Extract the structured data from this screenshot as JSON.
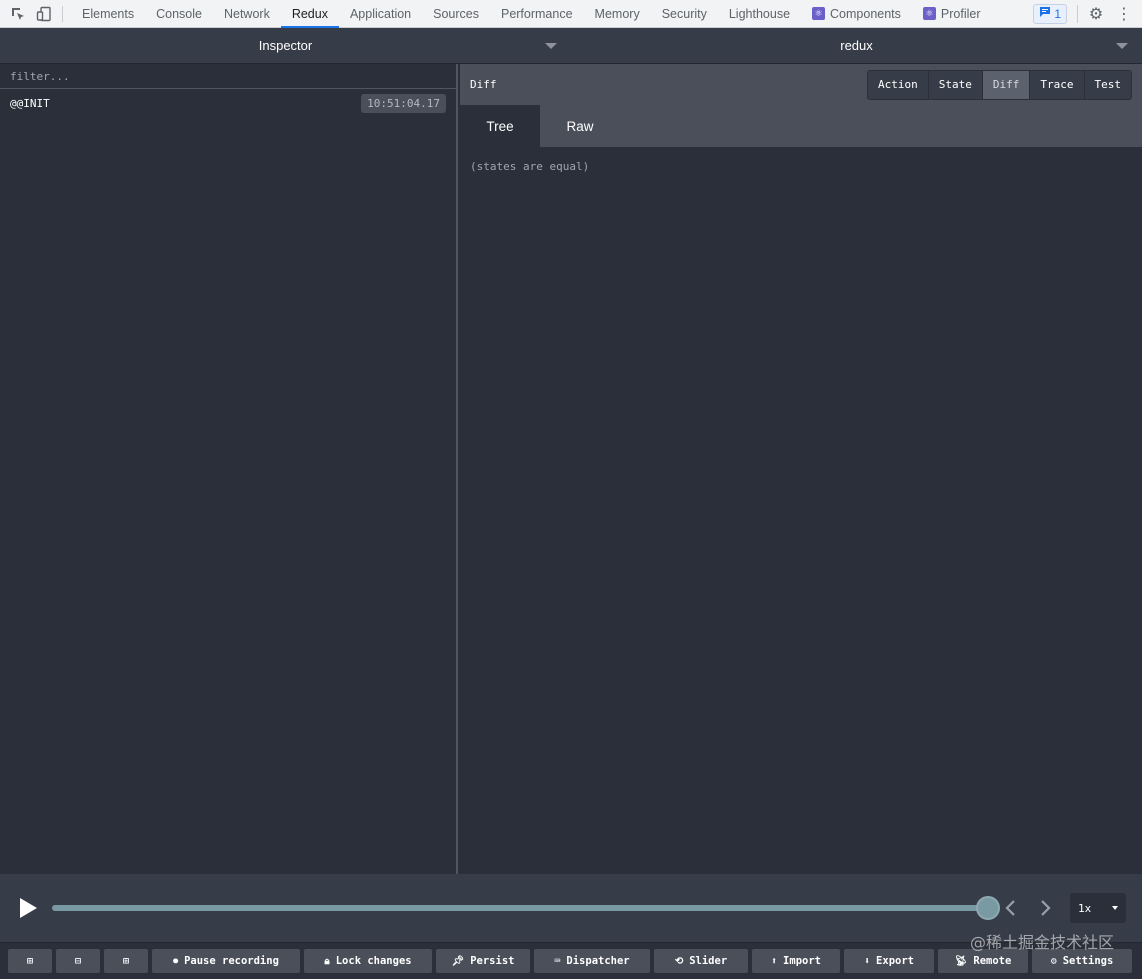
{
  "devtools": {
    "tabs": [
      {
        "label": "Elements"
      },
      {
        "label": "Console"
      },
      {
        "label": "Network"
      },
      {
        "label": "Redux",
        "active": true
      },
      {
        "label": "Application"
      },
      {
        "label": "Sources"
      },
      {
        "label": "Performance"
      },
      {
        "label": "Memory"
      },
      {
        "label": "Security"
      },
      {
        "label": "Lighthouse"
      },
      {
        "label": "Components",
        "icon": "react-icon"
      },
      {
        "label": "Profiler",
        "icon": "react-icon"
      }
    ],
    "issues_count": "1"
  },
  "monitor_header": {
    "left": "Inspector",
    "right": "redux"
  },
  "left_pane": {
    "filter_placeholder": "filter...",
    "actions": [
      {
        "name": "@@INIT",
        "time": "10:51:04.17"
      }
    ]
  },
  "right_pane": {
    "title": "Diff",
    "tabs": [
      "Action",
      "State",
      "Diff",
      "Trace",
      "Test"
    ],
    "active_tab": "Diff",
    "sub_tabs": [
      "Tree",
      "Raw"
    ],
    "active_sub_tab": "Tree",
    "message": "(states are equal)"
  },
  "slider": {
    "position": 1.0,
    "speed": "1x"
  },
  "bottom_bar": {
    "buttons": [
      {
        "label": "Pause recording",
        "icon": "pause-icon"
      },
      {
        "label": "Lock changes",
        "icon": "lock-icon"
      },
      {
        "label": "Persist",
        "icon": "pin-icon"
      },
      {
        "label": "Dispatcher",
        "icon": "keyboard-icon"
      },
      {
        "label": "Slider",
        "icon": "history-icon"
      },
      {
        "label": "Import",
        "icon": "upload-icon"
      },
      {
        "label": "Export",
        "icon": "download-icon"
      },
      {
        "label": "Remote",
        "icon": "antenna-icon"
      },
      {
        "label": "Settings",
        "icon": "gear-icon"
      }
    ]
  },
  "watermark": "@稀土掘金技术社区",
  "colors": {
    "background": "#2a2f3a",
    "header": "#363c48",
    "panel": "#4a4f5a",
    "devtools_accent": "#1a73e8",
    "slider": "#7a9aa3"
  }
}
